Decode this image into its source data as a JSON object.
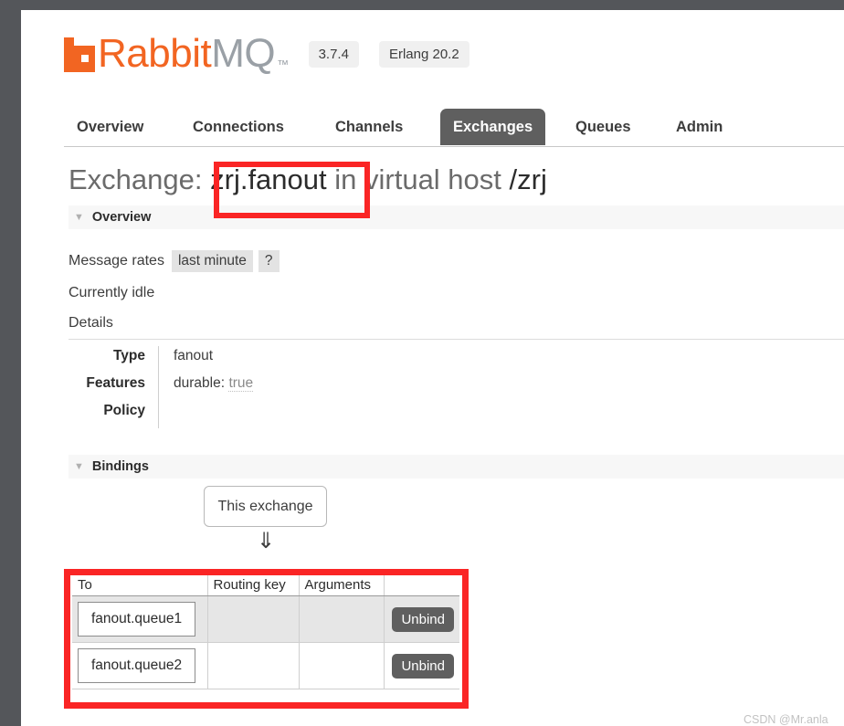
{
  "brand": {
    "name_primary": "Rabbit",
    "name_secondary": "MQ",
    "trademark": "™",
    "version_badge": "3.7.4",
    "erlang_badge": "Erlang 20.2"
  },
  "nav": {
    "tabs": [
      {
        "label": "Overview",
        "active": false
      },
      {
        "label": "Connections",
        "active": false
      },
      {
        "label": "Channels",
        "active": false
      },
      {
        "label": "Exchanges",
        "active": true
      },
      {
        "label": "Queues",
        "active": false
      },
      {
        "label": "Admin",
        "active": false
      }
    ]
  },
  "page_title": {
    "prefix": "Exchange:",
    "exchange_name": "zrj.fanout",
    "middle": "in virtual host",
    "vhost": "/zrj"
  },
  "overview_section": {
    "title": "Overview",
    "caret": "▼",
    "message_rates_label": "Message rates",
    "period_chip": "last minute",
    "help_chip": "?",
    "status_text": "Currently idle",
    "details_label": "Details",
    "details": [
      {
        "key": "Type",
        "value": "fanout"
      },
      {
        "key": "Features",
        "value_key": "durable:",
        "value_val": "true"
      },
      {
        "key": "Policy",
        "value": ""
      }
    ]
  },
  "bindings_section": {
    "title": "Bindings",
    "caret": "▼",
    "this_exchange_label": "This exchange",
    "arrow_glyph": "⇓",
    "table": {
      "columns": [
        "To",
        "Routing key",
        "Arguments",
        ""
      ],
      "rows": [
        {
          "to": "fanout.queue1",
          "routing_key": "",
          "arguments": "",
          "action": "Unbind"
        },
        {
          "to": "fanout.queue2",
          "routing_key": "",
          "arguments": "",
          "action": "Unbind"
        }
      ]
    }
  },
  "annotations": {
    "color": "#fa2525",
    "boxes": [
      "exchange-name-highlight",
      "bindings-table-highlight"
    ]
  },
  "watermark": {
    "text": "CSDN @Mr.anla"
  }
}
